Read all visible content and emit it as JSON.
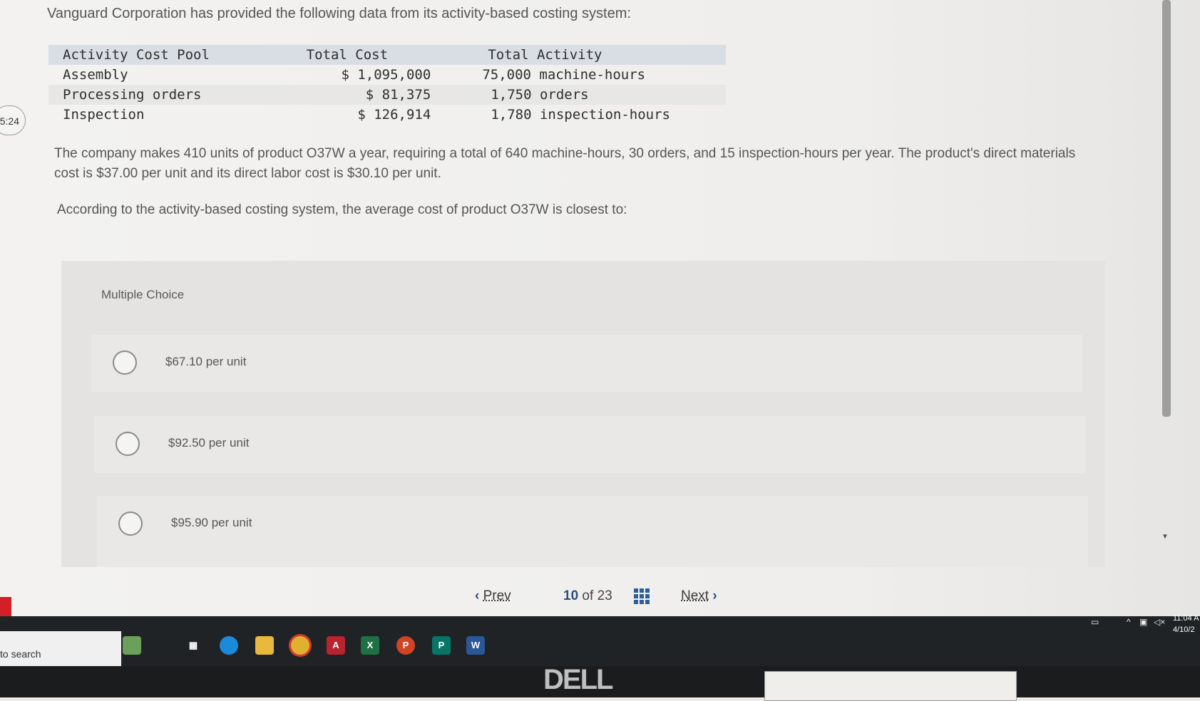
{
  "timer": "5:24",
  "intro": "Vanguard Corporation has provided the following data from its activity-based costing system:",
  "table": {
    "headers": [
      "Activity Cost Pool",
      "Total Cost",
      "Total Activity"
    ],
    "rows": [
      [
        "Assembly",
        "$ 1,095,000",
        "75,000 machine-hours"
      ],
      [
        "Processing orders",
        "$ 81,375",
        "1,750 orders"
      ],
      [
        "Inspection",
        "$ 126,914",
        "1,780 inspection-hours"
      ]
    ]
  },
  "paragraph1": "The company makes 410 units of product O37W a year, requiring a total of 640 machine-hours, 30 orders, and 15 inspection-hours per year. The product's direct materials cost is $37.00 per unit and its direct labor cost is $30.10 per unit.",
  "paragraph2": "According to the activity-based costing system, the average cost of product O37W is closest to:",
  "multiple_choice": {
    "label": "Multiple Choice",
    "options": [
      "$67.10 per unit",
      "$92.50 per unit",
      "$95.90 per unit"
    ]
  },
  "navigation": {
    "prev_label": "Prev",
    "current_page": "10",
    "of_label": "of",
    "total_pages": "23",
    "next_label": "Next"
  },
  "taskbar": {
    "search_text": "to search",
    "clock_time": "11:04 A",
    "clock_date": "4/10/2"
  },
  "bezel_brand": "DELL",
  "colors": {
    "nav_accent": "#2c4f7c",
    "table_header_bg": "#d9dde4"
  }
}
